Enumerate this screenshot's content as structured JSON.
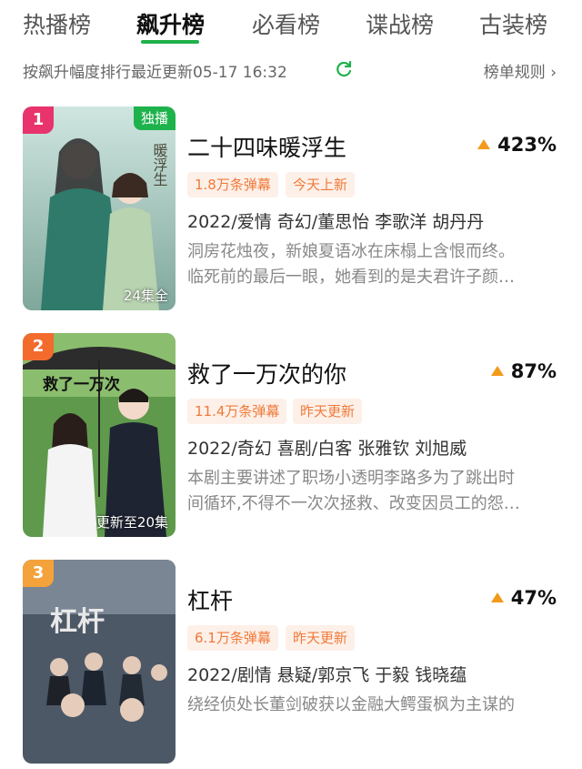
{
  "tabs": [
    "热播榜",
    "飙升榜",
    "必看榜",
    "谍战榜",
    "古装榜"
  ],
  "active_tab": "飙升榜",
  "subheader": {
    "info": "按飙升幅度排行最近更新05-17 16:32",
    "rules_label": "榜单规则 ›"
  },
  "colors": {
    "accent": "#1fb14a",
    "rise": "#f39a1a",
    "tag_text": "#ef7a3a",
    "tag_bg": "#fdf0e8"
  },
  "items": [
    {
      "rank": "1",
      "rank_color": "#e8336d",
      "badge": "独播",
      "episodes": "24集全",
      "title": "二十四味暖浮生",
      "rise": "423%",
      "tags": [
        "1.8万条弹幕",
        "今天上新"
      ],
      "meta": "2022/爱情 奇幻/董思怡 李歌洋 胡丹丹",
      "desc": [
        "洞房花烛夜，新娘夏语冰在床榻上含恨而终。",
        "临死前的最后一眼，她看到的是夫君许子颜…"
      ],
      "poster_text": "二十四味暖浮生"
    },
    {
      "rank": "2",
      "rank_color": "#f26b2d",
      "badge": "",
      "episodes": "更新至20集",
      "title": "救了一万次的你",
      "rise": "87%",
      "tags": [
        "11.4万条弹幕",
        "昨天更新"
      ],
      "meta": "2022/奇幻 喜剧/白客 张雅钦 刘旭威",
      "desc": [
        "本剧主要讲述了职场小透明李路多为了跳出时",
        "间循环,不得不一次次拯救、改变因员工的怨…"
      ],
      "poster_text": "救了一万次的你"
    },
    {
      "rank": "3",
      "rank_color": "#f4a23b",
      "badge": "",
      "episodes": "",
      "title": "杠杆",
      "rise": "47%",
      "tags": [
        "6.1万条弹幕",
        "昨天更新"
      ],
      "meta": "2022/剧情 悬疑/郭京飞 于毅 钱晓蕴",
      "desc": [
        "绕经侦处长董剑破获以金融大鳄蛋枫为主谋的",
        ""
      ],
      "poster_text": "杠杆"
    }
  ]
}
